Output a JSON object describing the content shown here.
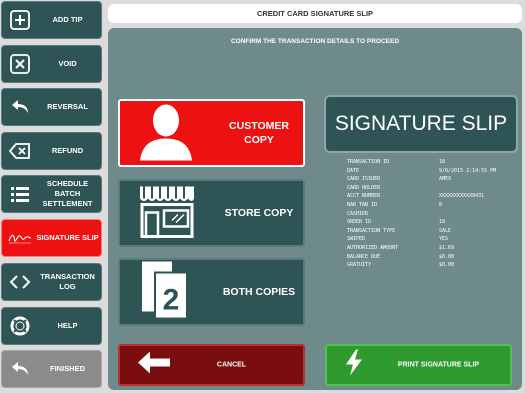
{
  "header": {
    "title": "CREDIT CARD SIGNATURE SLIP"
  },
  "sidebar": {
    "items": [
      {
        "label": "ADD TIP",
        "icon": "plus-square-icon"
      },
      {
        "label": "VOID",
        "icon": "x-square-icon"
      },
      {
        "label": "REVERSAL",
        "icon": "undo-arrow-icon"
      },
      {
        "label": "REFUND",
        "icon": "backspace-icon"
      },
      {
        "label": "SCHEDULE\nBATCH\nSETTLEMENT",
        "icon": "list-icon"
      },
      {
        "label": "SIGNATURE SLIP",
        "icon": "signature-icon",
        "active": true
      },
      {
        "label": "TRANSACTION\nLOG",
        "icon": "angle-brackets-icon"
      },
      {
        "label": "HELP",
        "icon": "lifebuoy-icon"
      },
      {
        "label": "FINISHED",
        "icon": "undo-arrow-icon"
      }
    ]
  },
  "main": {
    "instruction": "CONFIRM THE TRANSACTION DETAILS TO PROCEED",
    "copy_options": [
      {
        "label": "CUSTOMER\nCOPY",
        "icon": "person-icon",
        "selected": true
      },
      {
        "label": "STORE COPY",
        "icon": "storefront-icon",
        "selected": false
      },
      {
        "label": "BOTH COPIES",
        "icon": "two-copies-icon",
        "selected": false
      }
    ],
    "banner": "SIGNATURE SLIP",
    "details": [
      {
        "key": "TRANSACTION ID",
        "value": "18"
      },
      {
        "key": "DATE",
        "value": "9/8/2015 2:14:55 PM"
      },
      {
        "key": "CARD ISSUER",
        "value": "AMEX"
      },
      {
        "key": "CARD HOLDER",
        "value": ""
      },
      {
        "key": "ACCT NUMBER",
        "value": "XXXXXXXXXXX8431"
      },
      {
        "key": "BAR TAB ID",
        "value": "0"
      },
      {
        "key": "CASHIER",
        "value": ""
      },
      {
        "key": "ORDER ID",
        "value": "18"
      },
      {
        "key": "TRANSACTION TYPE",
        "value": "SALE"
      },
      {
        "key": "SWIPED",
        "value": "YES"
      },
      {
        "key": "AUTHORIZED AMOUNT",
        "value": "$1.69"
      },
      {
        "key": "BALANCE DUE",
        "value": "$0.00"
      },
      {
        "key": "GRATUITY",
        "value": "$0.00"
      }
    ],
    "cancel_label": "CANCEL",
    "print_label": "PRINT SIGNATURE SLIP"
  },
  "colors": {
    "accent_red": "#ee1111",
    "button_teal": "#2f5455",
    "panel_gray": "#6f8a8b",
    "print_green": "#2f9a2f",
    "cancel_dark_red": "#7a0d0d"
  }
}
